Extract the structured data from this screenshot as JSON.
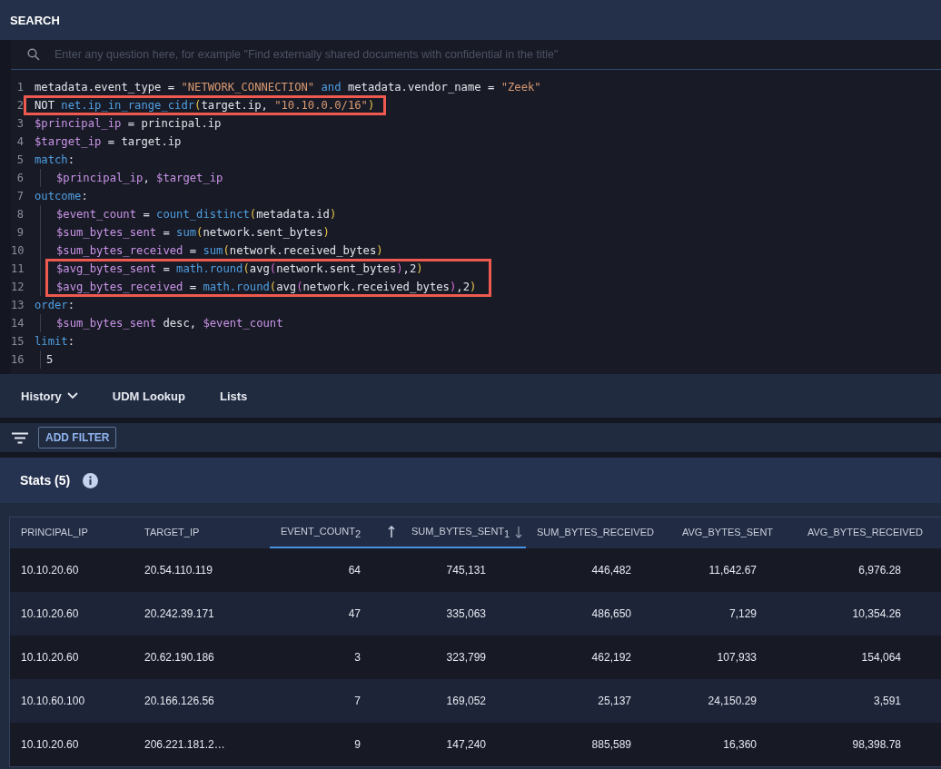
{
  "header": {
    "title": "SEARCH"
  },
  "search": {
    "placeholder": "Enter any question here, for example \"Find externally shared documents with confidential in the title\""
  },
  "code_lines": [
    {
      "number": "1",
      "indented": false,
      "boxed": false,
      "tokens": [
        {
          "kind": "plain",
          "text": "metadata.event_type = "
        },
        {
          "kind": "str",
          "text": "\"NETWORK_CONNECTION\""
        },
        {
          "kind": "kw",
          "text": " and "
        },
        {
          "kind": "plain",
          "text": "metadata.vendor_name = "
        },
        {
          "kind": "str",
          "text": "\"Zeek\""
        }
      ]
    },
    {
      "number": "2",
      "indented": false,
      "boxed": true,
      "tokens": [
        {
          "kind": "plain",
          "text": "NOT "
        },
        {
          "kind": "fn",
          "text": "net.ip_in_range_cidr"
        },
        {
          "kind": "br",
          "text": "("
        },
        {
          "kind": "plain",
          "text": "target.ip, "
        },
        {
          "kind": "str",
          "text": "\"10.10.0.0/16\""
        },
        {
          "kind": "br",
          "text": ")"
        }
      ]
    },
    {
      "number": "3",
      "indented": false,
      "boxed": false,
      "tokens": [
        {
          "kind": "var",
          "text": "$principal_ip"
        },
        {
          "kind": "plain",
          "text": " = principal.ip"
        }
      ]
    },
    {
      "number": "4",
      "indented": false,
      "boxed": false,
      "tokens": [
        {
          "kind": "var",
          "text": "$target_ip"
        },
        {
          "kind": "plain",
          "text": " = target.ip"
        }
      ]
    },
    {
      "number": "5",
      "indented": false,
      "boxed": false,
      "tokens": [
        {
          "kind": "kw",
          "text": "match"
        },
        {
          "kind": "plain",
          "text": ":"
        }
      ]
    },
    {
      "number": "6",
      "indented": true,
      "boxed": false,
      "tokens": [
        {
          "kind": "var",
          "text": "$principal_ip"
        },
        {
          "kind": "plain",
          "text": ", "
        },
        {
          "kind": "var",
          "text": "$target_ip"
        }
      ]
    },
    {
      "number": "7",
      "indented": false,
      "boxed": false,
      "tokens": [
        {
          "kind": "kw",
          "text": "outcome"
        },
        {
          "kind": "plain",
          "text": ":"
        }
      ]
    },
    {
      "number": "8",
      "indented": true,
      "boxed": false,
      "tokens": [
        {
          "kind": "var",
          "text": "$event_count"
        },
        {
          "kind": "plain",
          "text": " = "
        },
        {
          "kind": "fn",
          "text": "count_distinct"
        },
        {
          "kind": "br",
          "text": "("
        },
        {
          "kind": "plain",
          "text": "metadata.id"
        },
        {
          "kind": "br",
          "text": ")"
        }
      ]
    },
    {
      "number": "9",
      "indented": true,
      "boxed": false,
      "tokens": [
        {
          "kind": "var",
          "text": "$sum_bytes_sent"
        },
        {
          "kind": "plain",
          "text": " = "
        },
        {
          "kind": "fn",
          "text": "sum"
        },
        {
          "kind": "br",
          "text": "("
        },
        {
          "kind": "plain",
          "text": "network.sent_bytes"
        },
        {
          "kind": "br",
          "text": ")"
        }
      ]
    },
    {
      "number": "10",
      "indented": true,
      "boxed": false,
      "tokens": [
        {
          "kind": "var",
          "text": "$sum_bytes_received"
        },
        {
          "kind": "plain",
          "text": " = "
        },
        {
          "kind": "fn",
          "text": "sum"
        },
        {
          "kind": "br",
          "text": "("
        },
        {
          "kind": "plain",
          "text": "network.received_bytes"
        },
        {
          "kind": "br",
          "text": ")"
        }
      ]
    },
    {
      "number": "11",
      "indented": true,
      "boxed": true,
      "tokens": [
        {
          "kind": "var",
          "text": "$avg_bytes_sent"
        },
        {
          "kind": "plain",
          "text": " = "
        },
        {
          "kind": "fn",
          "text": "math.round"
        },
        {
          "kind": "br",
          "text": "("
        },
        {
          "kind": "plain",
          "text": "avg"
        },
        {
          "kind": "br2",
          "text": "("
        },
        {
          "kind": "plain",
          "text": "network.sent_bytes"
        },
        {
          "kind": "br2",
          "text": ")"
        },
        {
          "kind": "plain",
          "text": ",2"
        },
        {
          "kind": "br",
          "text": ")"
        }
      ]
    },
    {
      "number": "12",
      "indented": true,
      "boxed": true,
      "tokens": [
        {
          "kind": "var",
          "text": "$avg_bytes_received"
        },
        {
          "kind": "plain",
          "text": " = "
        },
        {
          "kind": "fn",
          "text": "math.round"
        },
        {
          "kind": "br",
          "text": "("
        },
        {
          "kind": "plain",
          "text": "avg"
        },
        {
          "kind": "br2",
          "text": "("
        },
        {
          "kind": "plain",
          "text": "network.received_bytes"
        },
        {
          "kind": "br2",
          "text": ")"
        },
        {
          "kind": "plain",
          "text": ",2"
        },
        {
          "kind": "br",
          "text": ")"
        }
      ]
    },
    {
      "number": "13",
      "indented": false,
      "boxed": false,
      "tokens": [
        {
          "kind": "kw",
          "text": "order"
        },
        {
          "kind": "plain",
          "text": ":"
        }
      ]
    },
    {
      "number": "14",
      "indented": true,
      "boxed": false,
      "tokens": [
        {
          "kind": "var",
          "text": "$sum_bytes_sent"
        },
        {
          "kind": "plain",
          "text": " desc, "
        },
        {
          "kind": "var",
          "text": "$event_count"
        }
      ]
    },
    {
      "number": "15",
      "indented": false,
      "boxed": false,
      "tokens": [
        {
          "kind": "kw",
          "text": "limit"
        },
        {
          "kind": "plain",
          "text": ":"
        }
      ]
    },
    {
      "number": "16",
      "indented": true,
      "boxed": false,
      "tokens": [
        {
          "kind": "plain",
          "text": "5"
        }
      ]
    }
  ],
  "tabs": [
    {
      "label": "History",
      "dropdown": true
    },
    {
      "label": "UDM Lookup",
      "dropdown": false
    },
    {
      "label": "Lists",
      "dropdown": false
    }
  ],
  "filter": {
    "button": "ADD FILTER"
  },
  "stats": {
    "title": "Stats (5)"
  },
  "table": {
    "columns": [
      {
        "label": "PRINCIPAL_IP",
        "kind": "text",
        "selected": false,
        "sorted": false
      },
      {
        "label": "TARGET_IP",
        "kind": "text",
        "selected": false,
        "sorted": false
      },
      {
        "label": "EVENT_COUNT",
        "kind": "number",
        "selected": true,
        "sorted": true,
        "descending": false,
        "sort_rank": "2"
      },
      {
        "label": "SUM_BYTES_SENT",
        "kind": "number",
        "selected": true,
        "sorted": true,
        "descending": true,
        "sort_rank": "1"
      },
      {
        "label": "SUM_BYTES_RECEIVED",
        "kind": "number",
        "selected": false,
        "sorted": false
      },
      {
        "label": "AVG_BYTES_SENT",
        "kind": "number",
        "selected": false,
        "sorted": false
      },
      {
        "label": "AVG_BYTES_RECEIVED",
        "kind": "number",
        "selected": false,
        "sorted": false
      }
    ],
    "rows": [
      [
        "10.10.20.60",
        "20.54.110.119",
        "64",
        "745,131",
        "446,482",
        "11,642.67",
        "6,976.28"
      ],
      [
        "10.10.20.60",
        "20.242.39.171",
        "47",
        "335,063",
        "486,650",
        "7,129",
        "10,354.26"
      ],
      [
        "10.10.20.60",
        "20.62.190.186",
        "3",
        "323,799",
        "462,192",
        "107,933",
        "154,064"
      ],
      [
        "10.10.60.100",
        "20.166.126.56",
        "7",
        "169,052",
        "25,137",
        "24,150.29",
        "3,591"
      ],
      [
        "10.10.20.60",
        "206.221.181.2…",
        "9",
        "147,240",
        "885,589",
        "16,360",
        "98,398.78"
      ]
    ]
  }
}
